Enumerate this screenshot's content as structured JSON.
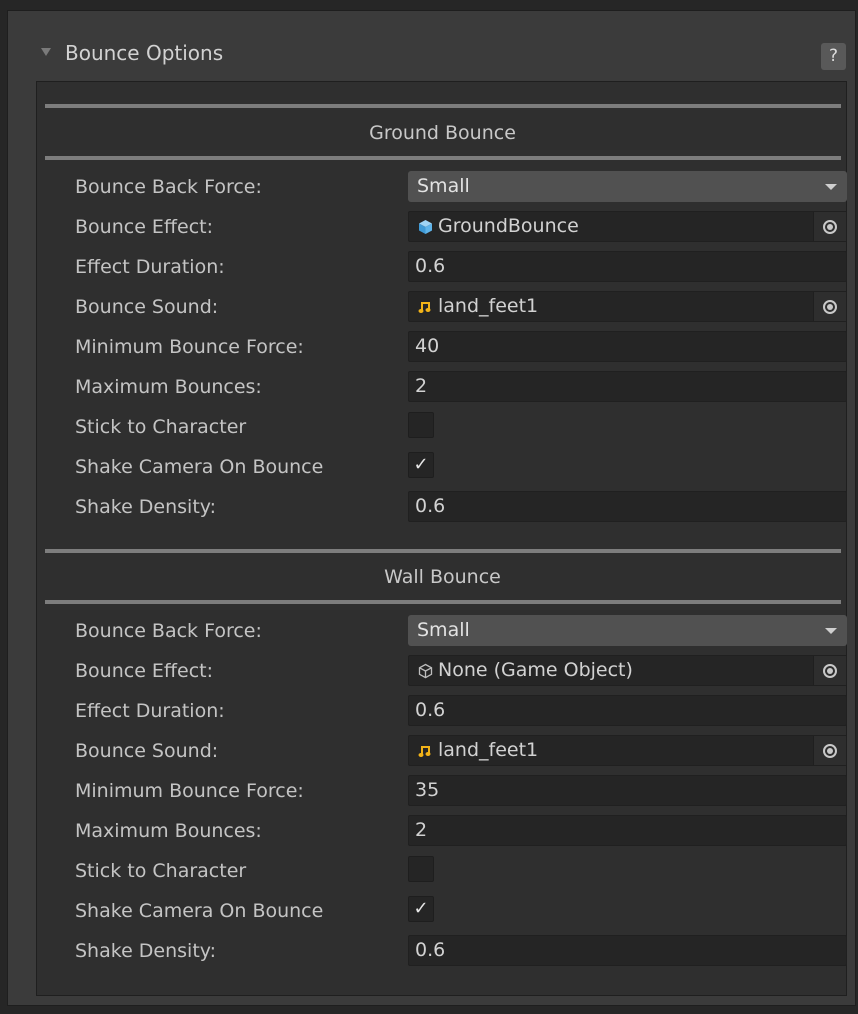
{
  "panel": {
    "title": "Bounce Options",
    "help_label": "?"
  },
  "ground": {
    "title": "Ground Bounce",
    "bounce_back_force_label": "Bounce Back Force:",
    "bounce_back_force_value": "Small",
    "bounce_effect_label": "Bounce Effect:",
    "bounce_effect_value": "GroundBounce",
    "bounce_effect_icon": "gameobject-prefab-icon",
    "effect_duration_label": "Effect Duration:",
    "effect_duration_value": "0.6",
    "bounce_sound_label": "Bounce Sound:",
    "bounce_sound_value": "land_feet1",
    "bounce_sound_icon": "audio-clip-icon",
    "min_bounce_force_label": "Minimum Bounce Force:",
    "min_bounce_force_value": "40",
    "max_bounces_label": "Maximum Bounces:",
    "max_bounces_value": "2",
    "stick_label": "Stick to Character",
    "stick_checked": false,
    "shake_label": "Shake Camera On Bounce",
    "shake_checked": true,
    "shake_density_label": "Shake Density:",
    "shake_density_value": "0.6"
  },
  "wall": {
    "title": "Wall Bounce",
    "bounce_back_force_label": "Bounce Back Force:",
    "bounce_back_force_value": "Small",
    "bounce_effect_label": "Bounce Effect:",
    "bounce_effect_value": "None (Game Object)",
    "bounce_effect_icon": "gameobject-empty-icon",
    "effect_duration_label": "Effect Duration:",
    "effect_duration_value": "0.6",
    "bounce_sound_label": "Bounce Sound:",
    "bounce_sound_value": "land_feet1",
    "bounce_sound_icon": "audio-clip-icon",
    "min_bounce_force_label": "Minimum Bounce Force:",
    "min_bounce_force_value": "35",
    "max_bounces_label": "Maximum Bounces:",
    "max_bounces_value": "2",
    "stick_label": "Stick to Character",
    "stick_checked": false,
    "shake_label": "Shake Camera On Bounce",
    "shake_checked": true,
    "shake_density_label": "Shake Density:",
    "shake_density_value": "0.6"
  },
  "colors": {
    "panel_bg": "#3b3b3b",
    "section_bg": "#2f2f2f",
    "field_bg": "#252525",
    "dropdown_bg": "#515151",
    "audio_icon": "#f2b318",
    "prefab_icon": "#5fb4ea"
  }
}
